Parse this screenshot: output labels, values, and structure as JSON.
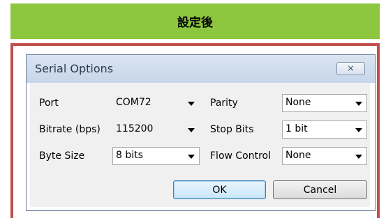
{
  "header": {
    "title": "設定後"
  },
  "dialog": {
    "title": "Serial Options",
    "close_label": "⨯",
    "fields": {
      "port": {
        "label": "Port",
        "value": "COM72"
      },
      "bitrate": {
        "label": "Bitrate (bps)",
        "value": "115200"
      },
      "byte_size": {
        "label": "Byte Size",
        "value": "8 bits"
      },
      "parity": {
        "label": "Parity",
        "value": "None"
      },
      "stop_bits": {
        "label": "Stop Bits",
        "value": "1 bit"
      },
      "flow_control": {
        "label": "Flow Control",
        "value": "None"
      }
    },
    "buttons": {
      "ok": "OK",
      "cancel": "Cancel"
    }
  },
  "colors": {
    "header_bg": "#8dc63f",
    "frame": "#c0504d",
    "dialog_title_bg": "#c6d6ea"
  }
}
